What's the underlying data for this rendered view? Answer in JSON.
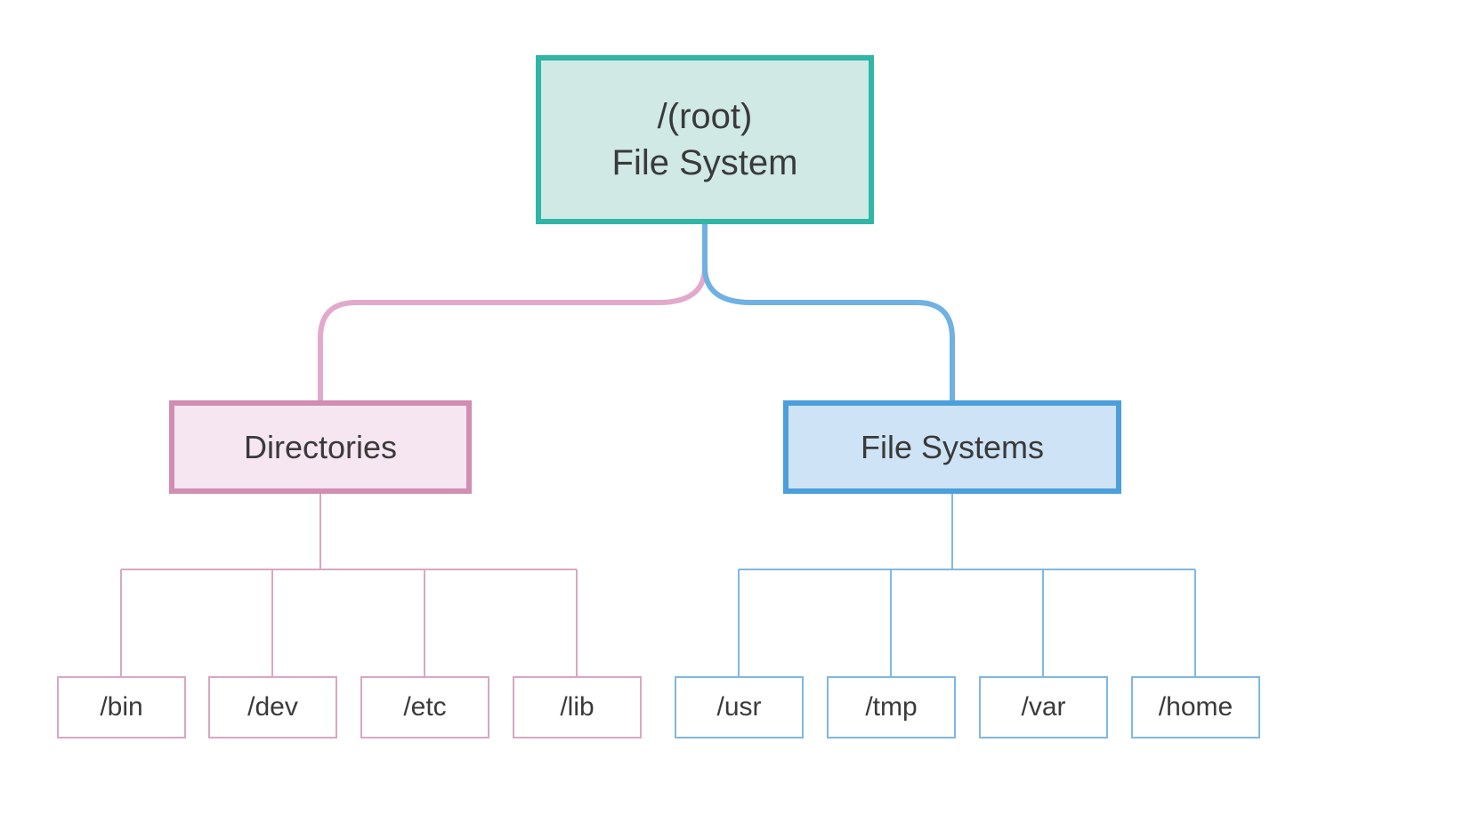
{
  "root": {
    "line1": "/(root)",
    "line2": "File System"
  },
  "branches": {
    "directories": {
      "label": "Directories",
      "children": {
        "bin": "/bin",
        "dev": "/dev",
        "etc": "/etc",
        "lib": "/lib"
      }
    },
    "filesystems": {
      "label": "File Systems",
      "children": {
        "usr": "/usr",
        "tmp": "/tmp",
        "var": "/var",
        "home": "/home"
      }
    }
  },
  "colors": {
    "teal": "#2fb6a6",
    "pink": "#d18db2",
    "blue": "#4b9fdb",
    "pink_thin": "#d9a7c3",
    "blue_thin": "#7fb8e3"
  }
}
